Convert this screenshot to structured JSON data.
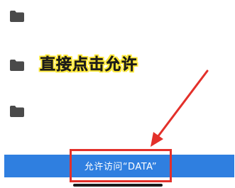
{
  "folders": [
    {
      "icon": "folder-icon"
    },
    {
      "icon": "folder-icon"
    },
    {
      "icon": "folder-icon"
    }
  ],
  "annotation": {
    "text": "直接点击允许",
    "highlight_color": "#ffe93a",
    "arrow_color": "#e3302a"
  },
  "allow_button": {
    "label": "允许访问“DATA”",
    "background_color": "#2f7fe0",
    "highlight_box_color": "#e3302a"
  }
}
